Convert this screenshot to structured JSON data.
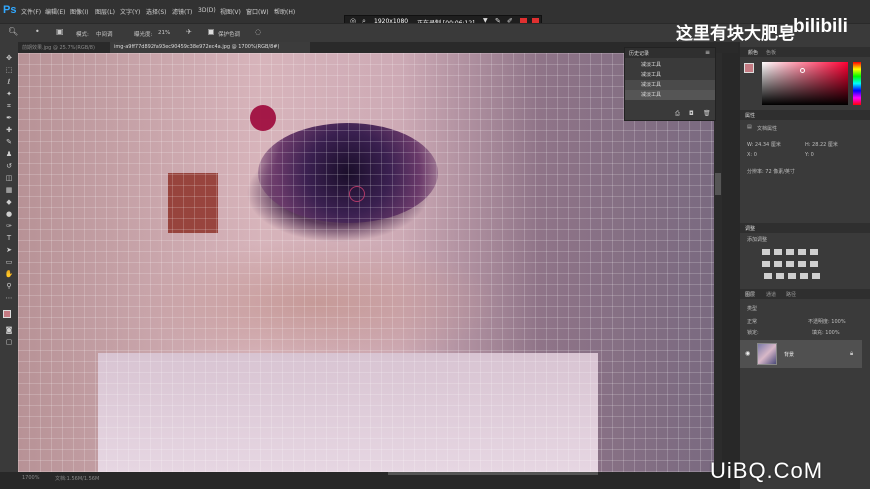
{
  "app": {
    "logo": "Ps"
  },
  "menu": [
    "文件(F)",
    "编辑(E)",
    "图像(I)",
    "图层(L)",
    "文字(Y)",
    "选择(S)",
    "滤镜(T)",
    "3D(D)",
    "视图(V)",
    "窗口(W)",
    "帮助(H)"
  ],
  "recorder": {
    "resolution": "1920x1080",
    "status": "正在录制 [00:06:12]"
  },
  "options": {
    "mode_label": "模式:",
    "mode_value": "中间调",
    "exposure_label": "曝光度:",
    "exposure_value": "21%",
    "protect_label": "保护色调"
  },
  "tabs": [
    {
      "label": "前期效果.jpg @ 25.7%(RGB/8)",
      "active": false
    },
    {
      "label": "img-a9ff77d892fa93ec90459c38e972ec4a.jpg @ 1700%(RGB/8#)",
      "active": true
    }
  ],
  "history": {
    "title": "历史记录",
    "items": [
      "减淡工具",
      "减淡工具",
      "减淡工具",
      "减淡工具"
    ]
  },
  "color_panel": {
    "tabs": [
      "颜色",
      "色板"
    ]
  },
  "properties": {
    "title": "属性",
    "doc_label": "文档属性",
    "w": "W:  24.34 厘米",
    "h": "H:  28.22 厘米",
    "x": "X:  0",
    "y": "Y:  0",
    "resolution": "分辨率: 72 像素/英寸"
  },
  "adjustments": {
    "title": "调整",
    "add_label": "添加调整"
  },
  "layers": {
    "tabs": [
      "图层",
      "通道",
      "路径"
    ],
    "kind": "类型",
    "blend": "正常",
    "opacity": "不透明度: 100%",
    "lock_label": "锁定:",
    "fill": "填充: 100%",
    "layer_name": "背景"
  },
  "status": {
    "zoom": "1700%",
    "doc": "文档:1.56M/1.56M"
  },
  "overlay": {
    "banner": "这里有块大肥皂",
    "bilibili": "bilibili",
    "watermark": "UiBQ.CoM"
  },
  "colors": {
    "accent": "#31a8ff",
    "foreground": "#c47a82",
    "record_red": "#e03030",
    "brush": "#a01040"
  }
}
